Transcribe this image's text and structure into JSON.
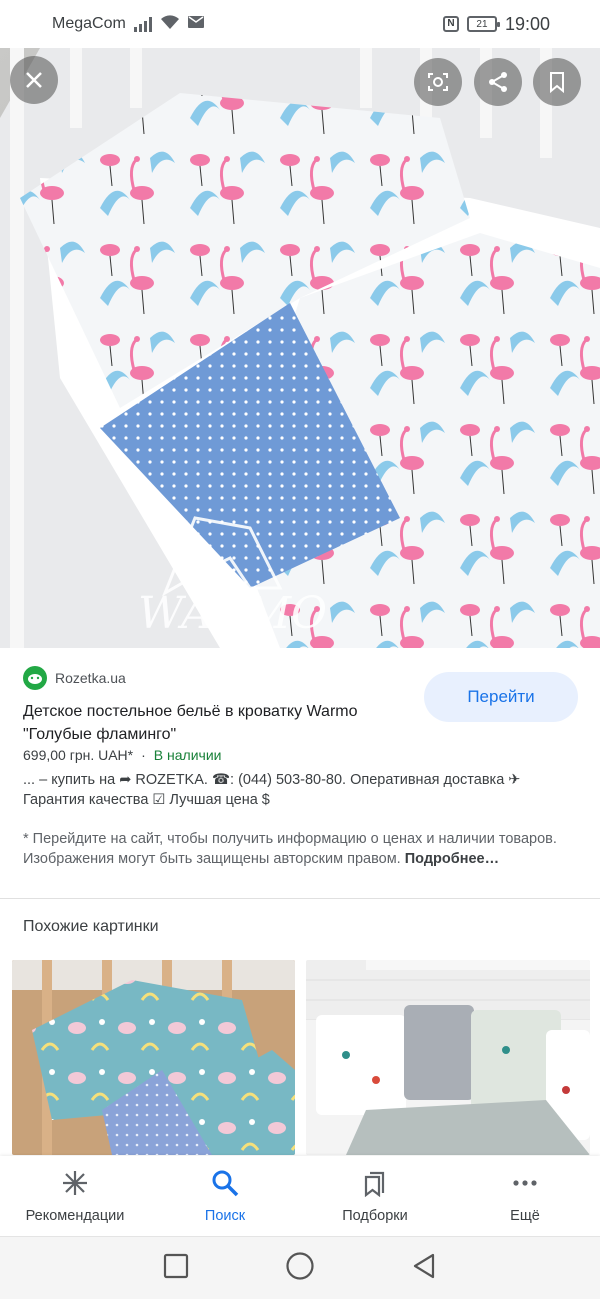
{
  "status_bar": {
    "carrier": "MegaCom",
    "battery": "21",
    "time": "19:00"
  },
  "hero": {
    "watermark": "WARMO"
  },
  "result": {
    "source": "Rozetka.ua",
    "go_button": "Перейти",
    "title": "Детское постельное бельё в кроватку Warmo \"Голубые фламинго\"",
    "price": "699,00 грн. UAH*",
    "price_sep": "·",
    "stock": "В наличии",
    "description": "... – купить на ➦ ROZETKA. ☎: (044) 503-80-80. Оперативная доставка ✈ Гарантия качества ☑ Лучшая цена $",
    "notice": "* Перейдите на сайт, чтобы получить информацию о ценах и наличии товаров. Изображения могут быть защищены авторским правом.",
    "more_link": "Подробнее…"
  },
  "similar": {
    "title": "Похожие картинки"
  },
  "bottom_nav": {
    "items": [
      {
        "label": "Рекомендации",
        "icon": "asterisk-icon"
      },
      {
        "label": "Поиск",
        "icon": "search-icon",
        "active": true
      },
      {
        "label": "Подборки",
        "icon": "collections-icon"
      },
      {
        "label": "Ещё",
        "icon": "more-dots-icon"
      }
    ]
  },
  "colors": {
    "accent": "#1a73e8",
    "stock_green": "#188038",
    "go_button_bg": "#e8f0fe"
  }
}
